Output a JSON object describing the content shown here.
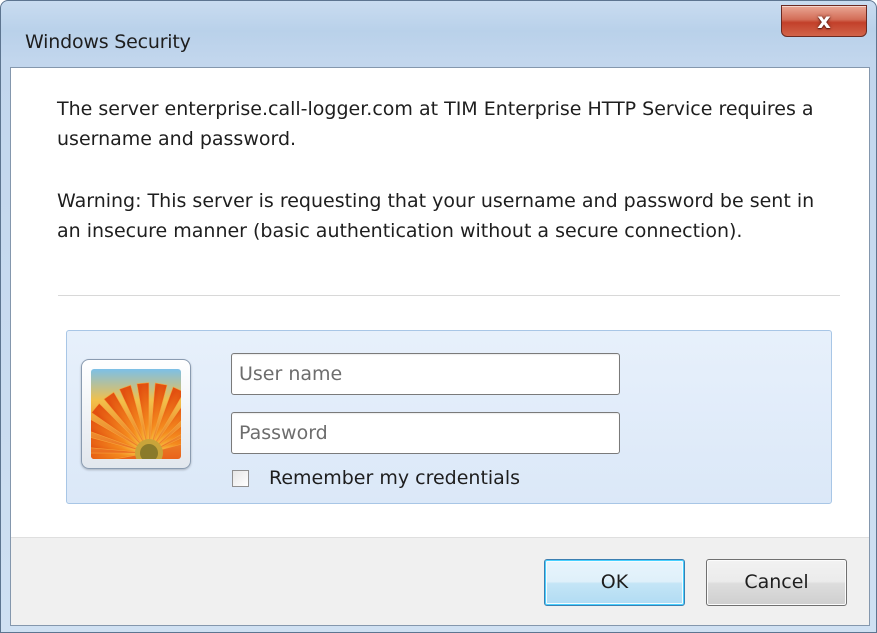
{
  "window": {
    "title": "Windows Security",
    "close_glyph": "x"
  },
  "message": {
    "line1": "The server enterprise.call-logger.com at TIM Enterprise HTTP Service requires a username and password.",
    "warning": "Warning: This server is requesting that your username and password be sent in an insecure manner (basic authentication without a secure connection)."
  },
  "credentials": {
    "username_placeholder": "User name",
    "password_placeholder": "Password",
    "remember_label": "Remember my credentials",
    "remember_checked": false,
    "avatar_icon": "flower-avatar-icon"
  },
  "buttons": {
    "ok": "OK",
    "cancel": "Cancel"
  },
  "colors": {
    "titlebar": "#b9d1ea",
    "close_button": "#c2402a",
    "credential_tile": "#dbe8f8",
    "ok_focus_border": "#3c7fb1",
    "footer": "#f0f0f0"
  }
}
